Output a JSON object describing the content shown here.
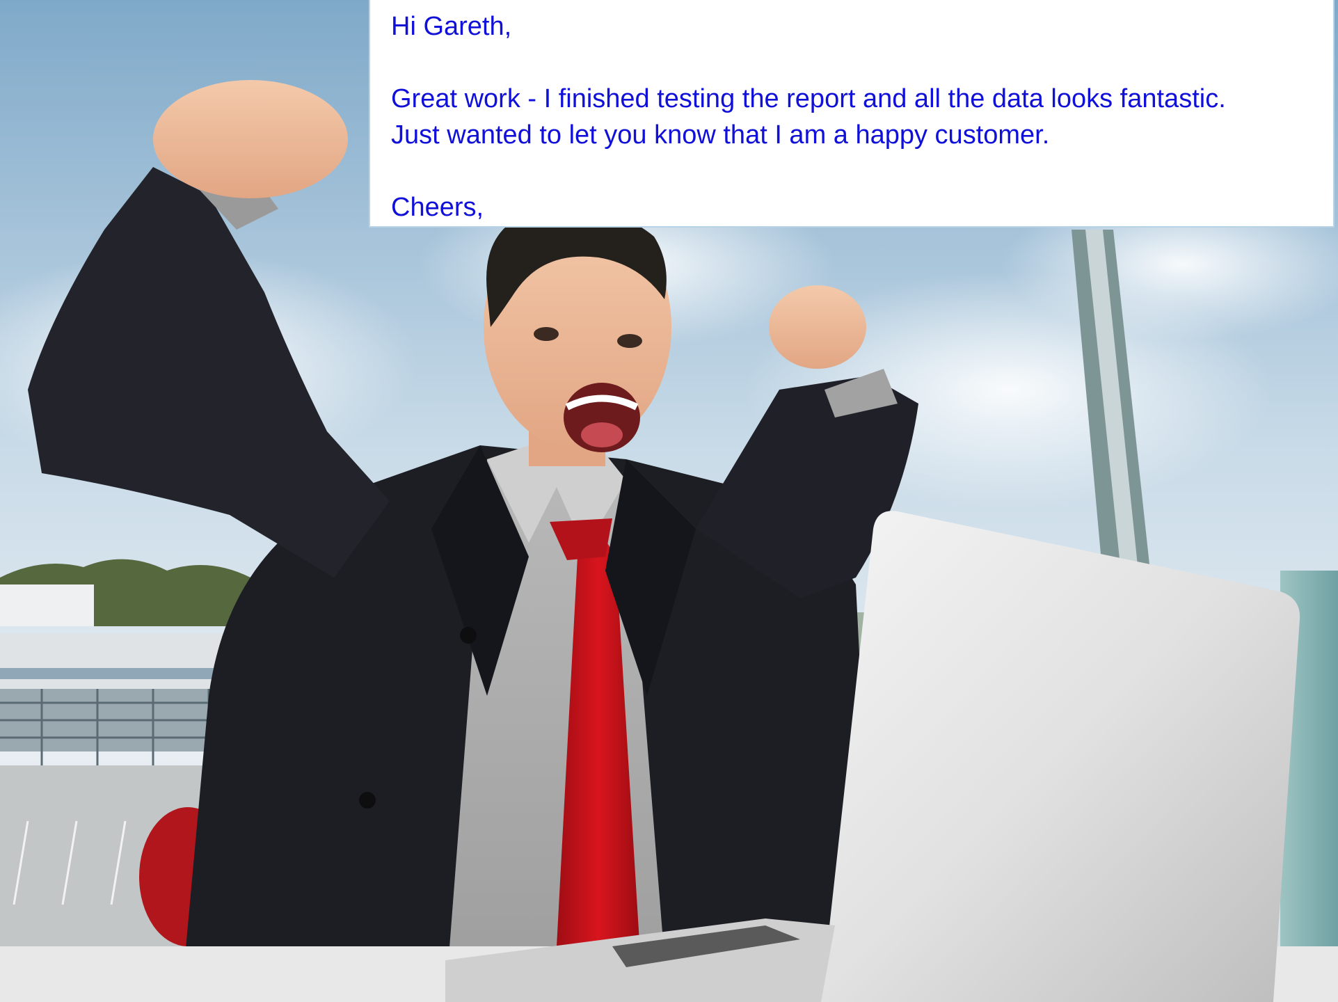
{
  "email": {
    "greeting": "Hi Gareth,",
    "body_line_1": "Great work - I finished testing the report and all the data looks fantastic.",
    "body_line_2": "Just wanted to let you know that I am a happy customer.",
    "signoff": "Cheers,",
    "text_color": "#1010d8"
  },
  "photo": {
    "subject": "excited-businessman",
    "tie_color": "#c8121a",
    "suit_color": "#1d1e24",
    "laptop_color": "#dcdcdc"
  }
}
